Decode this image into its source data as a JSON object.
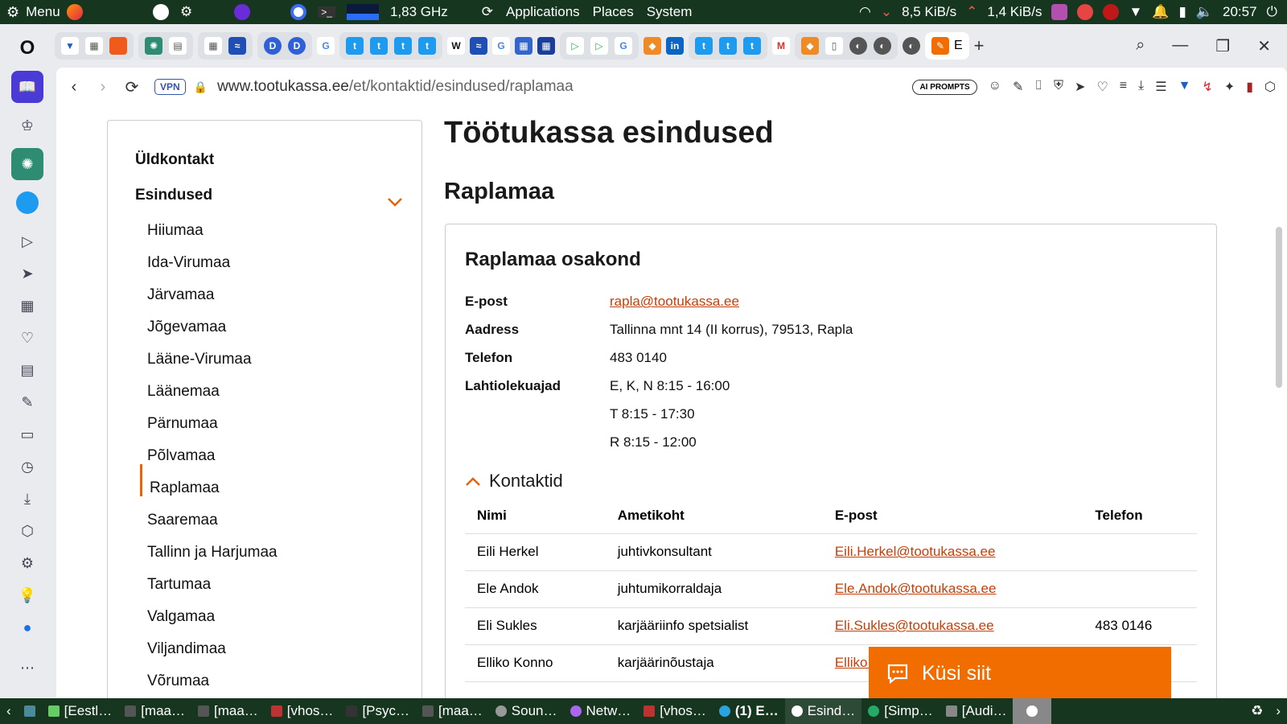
{
  "system_panel": {
    "menu_label": "Menu",
    "cpu_freq": "1,83 GHz",
    "apps": [
      "Applications",
      "Places",
      "System"
    ],
    "net_down": "8,5 KiB/s",
    "net_up": "1,4 KiB/s",
    "clock": "20:57"
  },
  "browser": {
    "active_tab_label": "E",
    "url_domain": "www.tootukassa.ee",
    "url_path": "/et/kontaktid/esindused/raplamaa",
    "vpn_label": "VPN",
    "ai_prompts_label": "AI PROMPTS"
  },
  "nav": {
    "general": "Üldkontakt",
    "section": "Esindused",
    "items": [
      "Hiiumaa",
      "Ida-Virumaa",
      "Järvamaa",
      "Jõgevamaa",
      "Lääne-Virumaa",
      "Läänemaa",
      "Pärnumaa",
      "Põlvamaa",
      "Raplamaa",
      "Saaremaa",
      "Tallinn ja Harjumaa",
      "Tartumaa",
      "Valgamaa",
      "Viljandimaa",
      "Võrumaa"
    ],
    "active": "Raplamaa"
  },
  "page": {
    "title": "Töötukassa esindused",
    "region": "Raplamaa"
  },
  "office": {
    "name": "Raplamaa osakond",
    "email_label": "E-post",
    "email": "rapla@tootukassa.ee",
    "address_label": "Aadress",
    "address": "Tallinna mnt 14 (II korrus), 79513, Rapla",
    "phone_label": "Telefon",
    "phone": "483 0140",
    "hours_label": "Lahtiolekuajad",
    "hours": [
      "E, K, N 8:15 - 16:00",
      "T 8:15 - 17:30",
      "R 8:15 - 12:00"
    ]
  },
  "contacts": {
    "heading": "Kontaktid",
    "columns": [
      "Nimi",
      "Ametikoht",
      "E-post",
      "Telefon"
    ],
    "rows": [
      {
        "name": "Eili Herkel",
        "role": "juhtivkonsultant",
        "email": "Eili.Herkel@tootukassa.ee",
        "phone": ""
      },
      {
        "name": "Ele Andok",
        "role": "juhtumikorraldaja",
        "email": "Ele.Andok@tootukassa.ee",
        "phone": ""
      },
      {
        "name": "Eli Sukles",
        "role": "karjääriinfo spetsialist",
        "email": "Eli.Sukles@tootukassa.ee",
        "phone": "483 0146"
      },
      {
        "name": "Elliko Konno",
        "role": "karjäärinõustaja",
        "email": "Elliko.Ko",
        "phone": ""
      }
    ]
  },
  "chat": {
    "label": "Küsi siit"
  },
  "taskbar": {
    "items": [
      "[Eestl…",
      "[maa…",
      "[maa…",
      "[vhos…",
      "[Psyc…",
      "[maa…",
      "Soun…",
      "Netw…",
      "[vhos…",
      "(1) E…",
      "Esind…",
      "[Simp…",
      "[Audi…"
    ]
  },
  "colors": {
    "accent": "#f26d00",
    "link": "#c4400a",
    "panel": "#16361f"
  }
}
